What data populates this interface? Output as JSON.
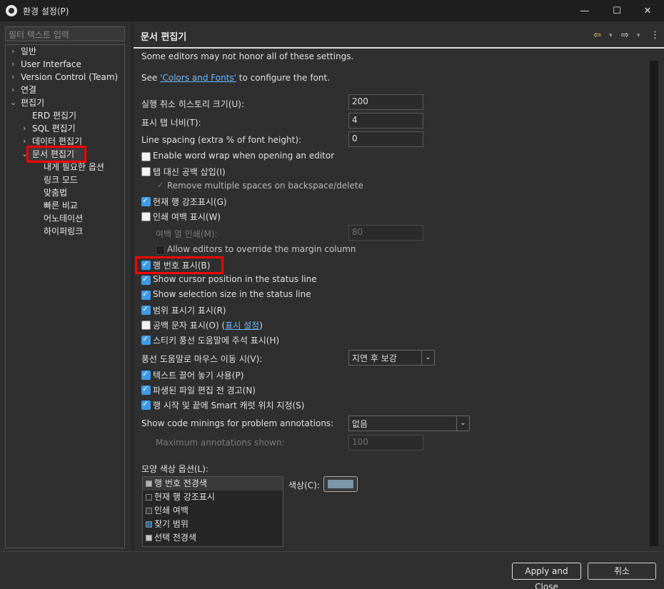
{
  "window": {
    "title": "환경 설정(P)",
    "min_label": "—",
    "max_label": "☐",
    "close_label": "✕"
  },
  "sidebar": {
    "filter_placeholder": "필터 텍스트 입력",
    "items": [
      {
        "label": "일반"
      },
      {
        "label": "User Interface"
      },
      {
        "label": "Version Control (Team)"
      },
      {
        "label": "연결"
      },
      {
        "label": "편집기"
      },
      {
        "label": "ERD 편집기"
      },
      {
        "label": "SQL 편집기"
      },
      {
        "label": "데이터 편집기"
      },
      {
        "label": "문서 편집기"
      },
      {
        "label": "내게 필요한 옵션"
      },
      {
        "label": "링크 모드"
      },
      {
        "label": "맞춤법"
      },
      {
        "label": "빠른 비교"
      },
      {
        "label": "어노테이션"
      },
      {
        "label": "하이퍼링크"
      }
    ]
  },
  "page": {
    "title": "문서 편집기",
    "note": "Some editors may not honor all of these settings.",
    "font_see": "See ",
    "font_link": "'Colors and Fonts'",
    "font_suffix": " to configure the font.",
    "undo_label": "실행 취소 히스토리 크기(U):",
    "undo_value": "200",
    "tab_label": "표시 탭 너비(T):",
    "tab_value": "4",
    "spacing_label": "Line spacing (extra % of font height):",
    "spacing_value": "0",
    "cb_wordwrap": "Enable word wrap when opening an editor",
    "cb_spaces": "탭 대신 공백 삽입(I)",
    "cb_backspace": "Remove multiple spaces on backspace/delete",
    "cb_highlight": "현재 행 강조표시(G)",
    "cb_margin": "인쇄 여백 표시(W)",
    "margin_col_label": "여백 열 인쇄(M):",
    "margin_col_value": "80",
    "cb_override": "Allow editors to override the margin column",
    "cb_linenum": "행 번호 표시(B)",
    "cb_cursor": "Show cursor position in the status line",
    "cb_selsize": "Show selection size in the status line",
    "cb_range": "범위 표시기 표시(R)",
    "cb_whitespace": "공백 문자 표시(O)",
    "ws_open": "(",
    "ws_link": "표시 설정",
    "ws_close": ")",
    "cb_sticky": "스티키 풍선 도움말에 주석 표시(H)",
    "hover_label": "풍선 도움말로 마우스 이동 시(V):",
    "hover_value": "지연 후 보강",
    "cb_dnd": "텍스트 끌어 놓기 사용(P)",
    "cb_derived": "파생된 파일 편집 전 경고(N)",
    "cb_smartcaret": "행 시작 및 끝에 Smart 캐럿 위치 지정(S)",
    "minings_label": "Show code minings for problem annotations:",
    "minings_value": "없음",
    "maxann_label": "Maximum annotations shown:",
    "maxann_value": "100",
    "appearance_label": "모양 색상 옵션(L):",
    "appearance_items": [
      {
        "label": "행 번호 전경색",
        "color": "#b4b4b4"
      },
      {
        "label": "현재 행 강조표시",
        "color": "#2a2a2a"
      },
      {
        "label": "인쇄 여백",
        "color": "#3a3a3a"
      },
      {
        "label": "찾기 범위",
        "color": "#2e6e9e"
      },
      {
        "label": "선택 전경색",
        "color": "#c8c8c8"
      }
    ],
    "color_label": "색상(C):",
    "color_value": "#7a96a8"
  },
  "footer": {
    "apply_close": "Apply and Close",
    "cancel": "취소"
  },
  "accent": "#3d9be9",
  "annotation_color": "#ff0000"
}
